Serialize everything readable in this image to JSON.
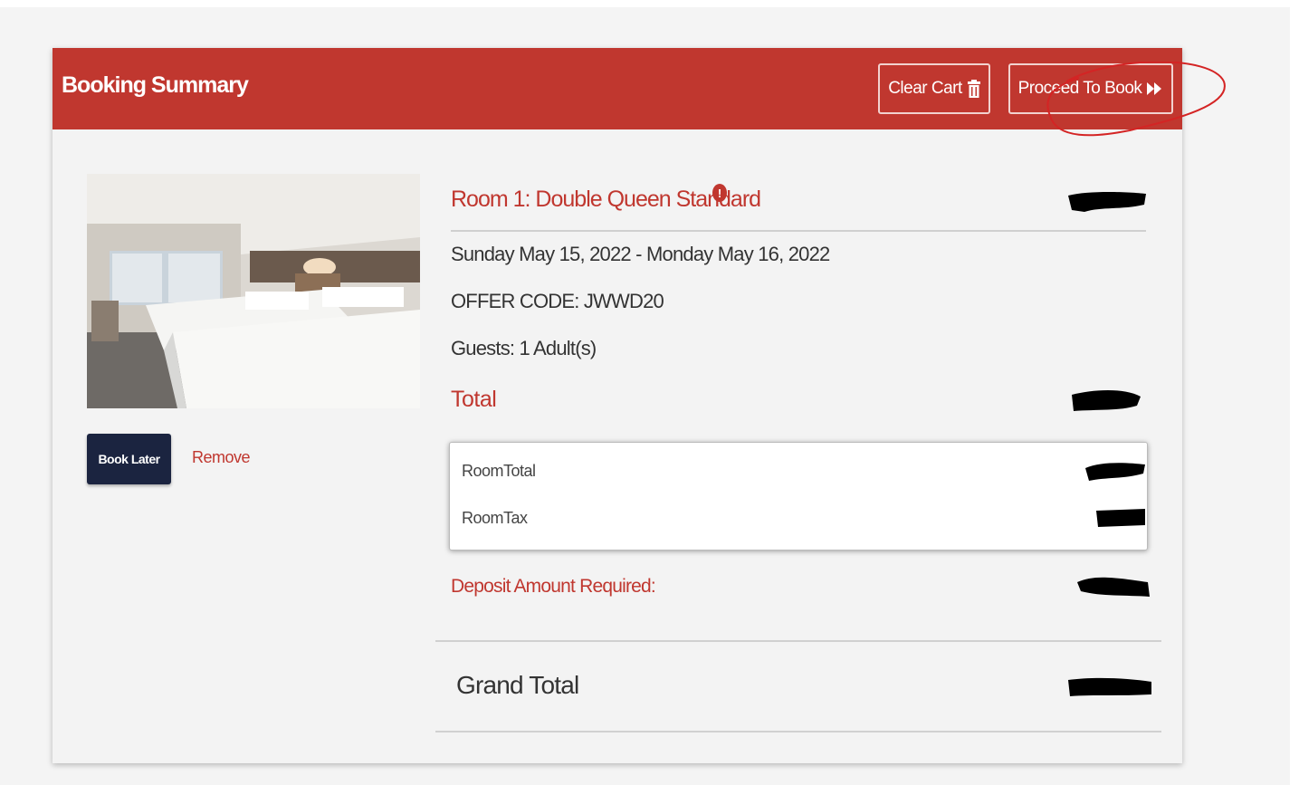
{
  "header": {
    "title": "Booking Summary",
    "clear_cart_label": "Clear Cart",
    "proceed_label": "Proceed To Book"
  },
  "room": {
    "title": "Room 1: Double Queen Standard",
    "info_badge": "!",
    "dates": "Sunday May 15, 2022 - Monday May 16, 2022",
    "offer_code": "OFFER CODE: JWWD20",
    "guests": "Guests:  1 Adult(s)"
  },
  "actions": {
    "book_later_label": "Book Later",
    "remove_label": "Remove"
  },
  "totals": {
    "total_label": "Total",
    "breakdown": [
      {
        "label": "RoomTotal"
      },
      {
        "label": "RoomTax"
      }
    ],
    "deposit_label": "Deposit Amount Required:",
    "grand_total_label": "Grand Total"
  },
  "colors": {
    "header_red": "#c0372f",
    "accent_red": "#c0372f",
    "navy": "#1b2440",
    "annotation_red": "#d42424"
  },
  "icons": {
    "clear_cart": "trash-icon",
    "proceed": "double-chevron-right-icon",
    "room_info": "info-icon"
  }
}
